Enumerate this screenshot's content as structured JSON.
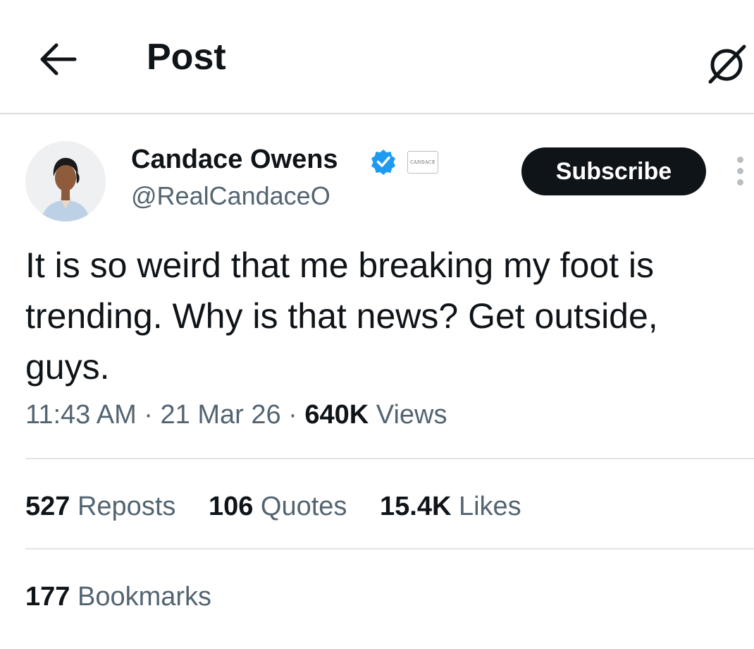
{
  "header": {
    "title": "Post",
    "back_icon": "arrow-left-icon",
    "grok_icon": "grok-icon"
  },
  "author": {
    "name": "Candace Owens",
    "handle": "@RealCandaceO",
    "verified_icon": "verified-badge-icon",
    "verified_color": "#1d9bf0",
    "affiliate_badge": "CANDACE",
    "subscribe_label": "Subscribe",
    "more_icon": "more-vertical-icon"
  },
  "post": {
    "text": "It is so weird that me breaking my foot is trending. Why is that news? Get outside, guys.",
    "time": "11:43 AM",
    "date": "21 Mar 26",
    "views_count": "640K",
    "views_label": "Views"
  },
  "stats": {
    "reposts_count": "527",
    "reposts_label": "Reposts",
    "quotes_count": "106",
    "quotes_label": "Quotes",
    "likes_count": "15.4K",
    "likes_label": "Likes",
    "bookmarks_count": "177",
    "bookmarks_label": "Bookmarks"
  }
}
